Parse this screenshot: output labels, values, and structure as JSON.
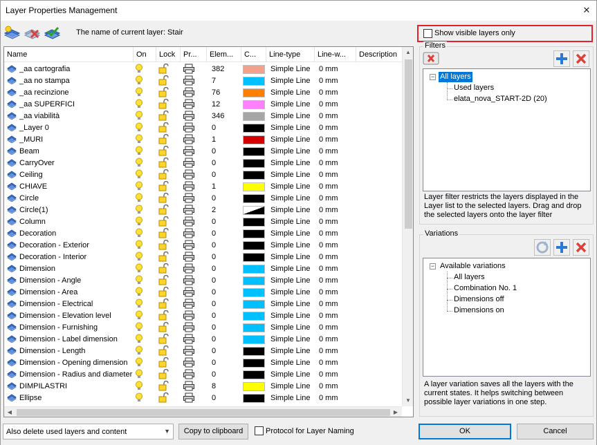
{
  "window": {
    "title": "Layer Properties Management",
    "close_glyph": "✕"
  },
  "toolbar": {
    "buttons": [
      {
        "name": "new-layer-icon"
      },
      {
        "name": "delete-layer-icon"
      },
      {
        "name": "set-current-layer-icon"
      }
    ],
    "current_layer_text": "The name of current layer: Stair"
  },
  "table": {
    "columns": [
      "Name",
      "On",
      "Lock",
      "Pr...",
      "Elem...",
      "C...",
      "Line-type",
      "Line-w...",
      "Description"
    ],
    "rows": [
      {
        "name": "_aa cartografia",
        "elements": "382",
        "color": "#f4a08a",
        "linetype": "Simple Line",
        "linewidth": "0 mm"
      },
      {
        "name": "_aa no stampa",
        "elements": "7",
        "color": "#00c0ff",
        "linetype": "Simple Line",
        "linewidth": "0 mm"
      },
      {
        "name": "_aa recinzione",
        "elements": "76",
        "color": "#ff8000",
        "linetype": "Simple Line",
        "linewidth": "0 mm"
      },
      {
        "name": "_aa SUPERFICI",
        "elements": "12",
        "color": "#ff80ff",
        "linetype": "Simple Line",
        "linewidth": "0 mm"
      },
      {
        "name": "_aa viabilità",
        "elements": "346",
        "color": "#a6a6a6",
        "linetype": "Simple Line",
        "linewidth": "0 mm"
      },
      {
        "name": "_Layer 0",
        "elements": "0",
        "color": "#000000",
        "linetype": "Simple Line",
        "linewidth": "0 mm"
      },
      {
        "name": "_MURI",
        "elements": "1",
        "color": "#d40000",
        "linetype": "Simple Line",
        "linewidth": "0 mm"
      },
      {
        "name": "Beam",
        "elements": "0",
        "color": "#000000",
        "linetype": "Simple Line",
        "linewidth": "0 mm"
      },
      {
        "name": "CarryOver",
        "elements": "0",
        "color": "#000000",
        "linetype": "Simple Line",
        "linewidth": "0 mm"
      },
      {
        "name": "Ceiling",
        "elements": "0",
        "color": "#000000",
        "linetype": "Simple Line",
        "linewidth": "0 mm"
      },
      {
        "name": "CHIAVE",
        "elements": "1",
        "color": "#ffff00",
        "linetype": "Simple Line",
        "linewidth": "0 mm"
      },
      {
        "name": "Circle",
        "elements": "0",
        "color": "#000000",
        "linetype": "Simple Line",
        "linewidth": "0 mm"
      },
      {
        "name": "Circle(1)",
        "elements": "2",
        "color": "#000000",
        "diag": true,
        "linetype": "Simple Line",
        "linewidth": "0 mm"
      },
      {
        "name": "Column",
        "elements": "0",
        "color": "#000000",
        "linetype": "Simple Line",
        "linewidth": "0 mm"
      },
      {
        "name": "Decoration",
        "elements": "0",
        "color": "#000000",
        "linetype": "Simple Line",
        "linewidth": "0 mm"
      },
      {
        "name": "Decoration - Exterior",
        "elements": "0",
        "color": "#000000",
        "linetype": "Simple Line",
        "linewidth": "0 mm"
      },
      {
        "name": "Decoration - Interior",
        "elements": "0",
        "color": "#000000",
        "linetype": "Simple Line",
        "linewidth": "0 mm"
      },
      {
        "name": "Dimension",
        "elements": "0",
        "color": "#00c0ff",
        "linetype": "Simple Line",
        "linewidth": "0 mm"
      },
      {
        "name": "Dimension - Angle",
        "elements": "0",
        "color": "#00c0ff",
        "linetype": "Simple Line",
        "linewidth": "0 mm"
      },
      {
        "name": "Dimension - Area",
        "elements": "0",
        "color": "#00c0ff",
        "linetype": "Simple Line",
        "linewidth": "0 mm"
      },
      {
        "name": "Dimension - Electrical",
        "elements": "0",
        "color": "#00c0ff",
        "linetype": "Simple Line",
        "linewidth": "0 mm"
      },
      {
        "name": "Dimension - Elevation level",
        "elements": "0",
        "color": "#00c0ff",
        "linetype": "Simple Line",
        "linewidth": "0 mm"
      },
      {
        "name": "Dimension - Furnishing",
        "elements": "0",
        "color": "#00c0ff",
        "linetype": "Simple Line",
        "linewidth": "0 mm"
      },
      {
        "name": "Dimension - Label dimension",
        "elements": "0",
        "color": "#00c0ff",
        "linetype": "Simple Line",
        "linewidth": "0 mm"
      },
      {
        "name": "Dimension - Length",
        "elements": "0",
        "color": "#000000",
        "linetype": "Simple Line",
        "linewidth": "0 mm"
      },
      {
        "name": "Dimension - Opening dimension",
        "elements": "0",
        "color": "#000000",
        "linetype": "Simple Line",
        "linewidth": "0 mm"
      },
      {
        "name": "Dimension - Radius and diameter",
        "elements": "0",
        "color": "#000000",
        "linetype": "Simple Line",
        "linewidth": "0 mm"
      },
      {
        "name": "DIMPILASTRI",
        "elements": "8",
        "color": "#ffff00",
        "linetype": "Simple Line",
        "linewidth": "0 mm"
      },
      {
        "name": "Ellipse",
        "elements": "0",
        "color": "#000000",
        "linetype": "Simple Line",
        "linewidth": "0 mm"
      }
    ]
  },
  "right_panel": {
    "show_visible_label": "Show visible layers only",
    "filters_title": "Filters",
    "filters_tree": {
      "root": "All layers",
      "children": [
        "Used layers",
        "elata_nova_START-2D (20)"
      ]
    },
    "filters_description": "Layer filter restricts the layers displayed in the Layer list to the selected layers. Drag and drop the selected layers onto the layer filter",
    "variations_title": "Variations",
    "variations_tree": {
      "root": "Available variations",
      "children": [
        "All layers",
        "Combination No. 1",
        "Dimensions off",
        "Dimensions on"
      ]
    },
    "variations_description": "A layer variation saves all the layers with the current states. It helps switching between possible layer variations in one step."
  },
  "bottom": {
    "delete_option": "Also delete used layers and content",
    "copy_button": "Copy to clipboard",
    "protocol_label": "Protocol for Layer Naming",
    "ok_button": "OK",
    "cancel_button": "Cancel"
  },
  "colors": {
    "accent": "#0078d7",
    "highlight_border": "#e2212b"
  }
}
